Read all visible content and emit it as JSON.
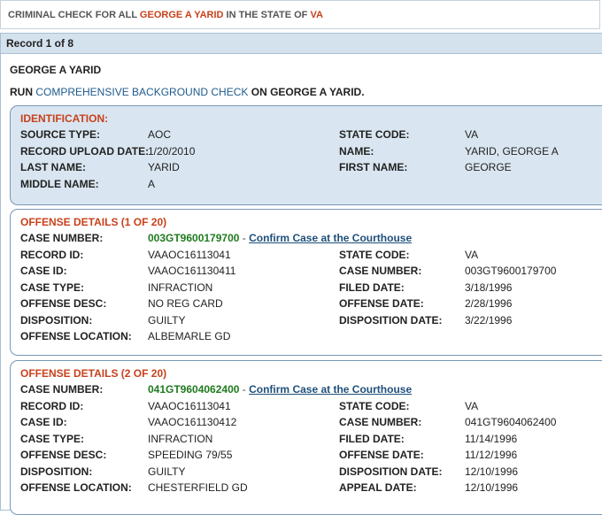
{
  "header": {
    "prefix": "CRIMINAL CHECK FOR ALL",
    "name": "GEORGE A YARID",
    "middle": "IN THE STATE OF",
    "state": "VA"
  },
  "record_bar": "Record 1 of 8",
  "person_name": "GEORGE A YARID",
  "run": {
    "prefix": "RUN",
    "link": "COMPREHENSIVE BACKGROUND CHECK",
    "suffix": "ON GEORGE A YARID."
  },
  "identification": {
    "title": "IDENTIFICATION:",
    "rows": [
      {
        "l1": "SOURCE TYPE:",
        "v1": "AOC",
        "l2": "STATE CODE:",
        "v2": "VA"
      },
      {
        "l1": "RECORD UPLOAD DATE:",
        "v1": "1/20/2010",
        "l2": "NAME:",
        "v2": "YARID, GEORGE A"
      },
      {
        "l1": "LAST NAME:",
        "v1": "YARID",
        "l2": "FIRST NAME:",
        "v2": "GEORGE"
      },
      {
        "l1": "MIDDLE NAME:",
        "v1": "A",
        "l2": "",
        "v2": ""
      }
    ]
  },
  "offenses": [
    {
      "title": "OFFENSE DETAILS (1 OF 20)",
      "case_label": "CASE NUMBER:",
      "case_number": "003GT9600179700",
      "separator": " - ",
      "confirm": "Confirm Case at the Courthouse",
      "rows": [
        {
          "l1": "RECORD ID:",
          "v1": "VAAOC16113041",
          "l2": "STATE CODE:",
          "v2": "VA"
        },
        {
          "l1": "CASE ID:",
          "v1": "VAAOC161130411",
          "l2": "CASE NUMBER:",
          "v2": "003GT9600179700"
        },
        {
          "l1": "CASE TYPE:",
          "v1": "INFRACTION",
          "l2": "FILED DATE:",
          "v2": "3/18/1996"
        },
        {
          "l1": "OFFENSE DESC:",
          "v1": "NO REG CARD",
          "l2": "OFFENSE DATE:",
          "v2": "2/28/1996"
        },
        {
          "l1": "DISPOSITION:",
          "v1": "GUILTY",
          "l2": "DISPOSITION DATE:",
          "v2": "3/22/1996"
        },
        {
          "l1": "OFFENSE LOCATION:",
          "v1": "ALBEMARLE GD",
          "l2": "",
          "v2": ""
        }
      ]
    },
    {
      "title": "OFFENSE DETAILS (2 OF 20)",
      "case_label": "CASE NUMBER:",
      "case_number": "041GT9604062400",
      "separator": " - ",
      "confirm": "Confirm Case at the Courthouse",
      "rows": [
        {
          "l1": "RECORD ID:",
          "v1": "VAAOC16113041",
          "l2": "STATE CODE:",
          "v2": "VA"
        },
        {
          "l1": "CASE ID:",
          "v1": "VAAOC161130412",
          "l2": "CASE NUMBER:",
          "v2": "041GT9604062400"
        },
        {
          "l1": "CASE TYPE:",
          "v1": "INFRACTION",
          "l2": "FILED DATE:",
          "v2": "11/14/1996"
        },
        {
          "l1": "OFFENSE DESC:",
          "v1": "SPEEDING 79/55",
          "l2": "OFFENSE DATE:",
          "v2": "11/12/1996"
        },
        {
          "l1": "DISPOSITION:",
          "v1": "GUILTY",
          "l2": "DISPOSITION DATE:",
          "v2": "12/10/1996"
        },
        {
          "l1": "OFFENSE LOCATION:",
          "v1": "CHESTERFIELD GD",
          "l2": "APPEAL DATE:",
          "v2": "12/10/1996"
        }
      ]
    }
  ]
}
